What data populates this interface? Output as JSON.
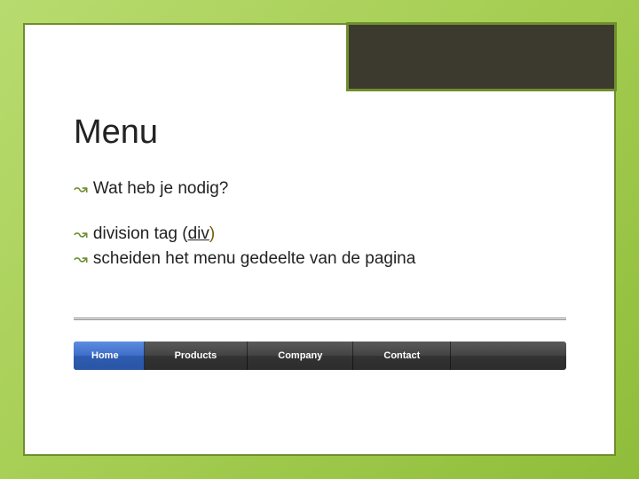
{
  "heading": "Menu",
  "bullets": {
    "b1": "Wat heb je nodig?",
    "b2_pre": "division tag (",
    "b2_under": "div",
    "b2_post": ")",
    "b3": "scheiden het menu gedeelte van de pagina"
  },
  "menu": {
    "items": [
      "Home",
      "Products",
      "Company",
      "Contact"
    ]
  }
}
